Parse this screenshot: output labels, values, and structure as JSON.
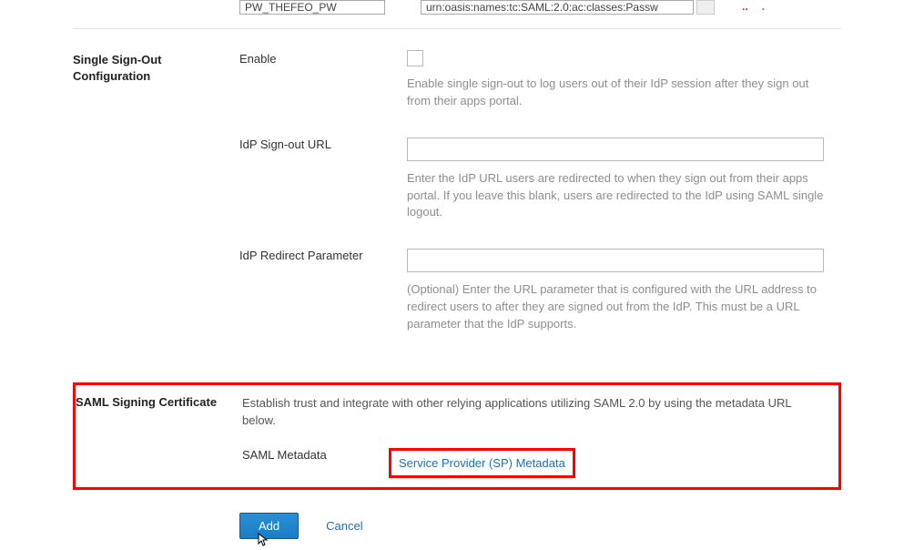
{
  "topRow": {
    "leftFieldValue": "PW_THEFEO_PW",
    "rightFieldValue": "urn:oasis:names:tc:SAML:2.0:ac:classes:Passw"
  },
  "sso": {
    "sectionTitle": "Single Sign-Out Configuration",
    "enableLabel": "Enable",
    "enableHelp": "Enable single sign-out to log users out of their IdP session after they sign out from their apps portal.",
    "signoutUrlLabel": "IdP Sign-out URL",
    "signoutUrlValue": "",
    "signoutUrlHelp": "Enter the IdP URL users are redirected to when they sign out from their apps portal. If you leave this blank, users are redirected to the IdP using SAML single logout.",
    "redirectParamLabel": "IdP Redirect Parameter",
    "redirectParamValue": "",
    "redirectParamHelp": "(Optional) Enter the URL parameter that is configured with the URL address to redirect users to after they are signed out from the IdP. This must be a URL parameter that the IdP supports."
  },
  "cert": {
    "sectionTitle": "SAML Signing Certificate",
    "desc": "Establish trust and integrate with other relying applications utilizing SAML 2.0 by using the metadata URL below.",
    "metadataLabel": "SAML Metadata",
    "spMetadataLink": "Service Provider (SP) Metadata"
  },
  "actions": {
    "add": "Add",
    "cancel": "Cancel"
  }
}
